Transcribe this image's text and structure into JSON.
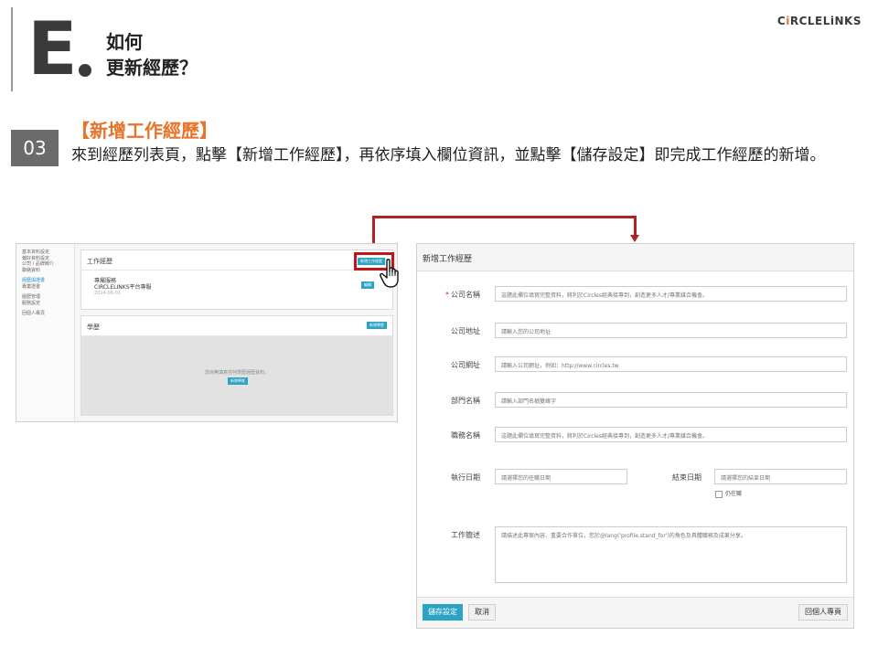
{
  "slide": {
    "letter": "E",
    "title_line1": "如何",
    "title_line2": "更新經歷？",
    "brand_pre": "C",
    "brand_i": "i",
    "brand_post": "RCLELiNKS"
  },
  "step": {
    "number": "03",
    "title": "【新增工作經歷】",
    "description": "來到經歷列表頁，點擊【新增工作經歷】，再依序填入欄位資訊，並點擊【儲存設定】即完成工作經歷的新增。"
  },
  "mini": {
    "sidebar": [
      "基本資料設定",
      "偏好資料設定",
      "公司 / 品牌簡介",
      "聯絡資料",
      "",
      "經歷與證書",
      "專業證書",
      "",
      "履歷管理",
      "服務設定",
      "",
      "回個人專頁"
    ],
    "work_card": {
      "title": "工作經歷",
      "add_button": "新增工作經歷",
      "entry_title": "專屬服務",
      "entry_company": "CIRCLELINKS平台專服",
      "entry_date": "2014-06-01",
      "edit_button": "編輯"
    },
    "edu_card": {
      "title": "學歷",
      "add_button": "新增學歷",
      "empty_text": "您尚無填寫任何學歷經歷資料。",
      "empty_button": "新增學歷"
    }
  },
  "form": {
    "header": "新增工作經歷",
    "fields": {
      "company_name": {
        "label": "公司名稱",
        "placeholder": "這題此欄位填寫完整資料，將利於Circles經典接專到，創造更多人才/專業媒合機會。"
      },
      "company_address": {
        "label": "公司地址",
        "placeholder": "請輸入您的公司地址"
      },
      "company_website": {
        "label": "公司網址",
        "placeholder": "請輸入公司網址，例如：http://www.circles.tw"
      },
      "department": {
        "label": "部門名稱",
        "placeholder": "請輸入部門名稱雙峰字"
      },
      "position": {
        "label": "職務名稱",
        "placeholder": "這題此欄位填寫完整資料，將利於Circles經典接專到，創造更多人才/專業媒合機會。"
      },
      "start_date": {
        "label": "執行日期",
        "placeholder": "請選擇您的任職日期"
      },
      "end_date": {
        "label": "結束日期",
        "placeholder": "請選擇您的結束日期"
      },
      "still_employed": {
        "label": "仍在職"
      },
      "description": {
        "label": "工作簡述",
        "placeholder": "請描述此專案內容、重要合作單位，您於@lang('profile.stand_for')的角色及具體職務及成果分享。"
      }
    },
    "buttons": {
      "save": "儲存設定",
      "cancel": "取消",
      "back": "回個人專頁"
    }
  },
  "colors": {
    "accent_orange": "#e8732a",
    "highlight_red": "#c0141a",
    "arrow_red": "#b22222",
    "button_teal": "#2aa3c4",
    "step_badge": "#6b6b6b"
  }
}
